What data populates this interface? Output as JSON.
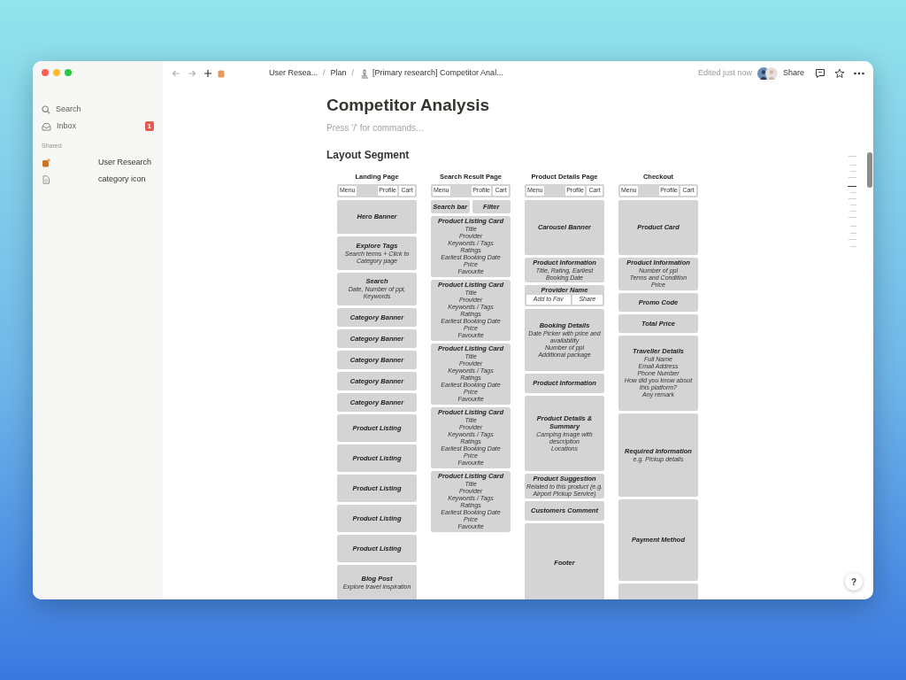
{
  "sidebar": {
    "search": "Search",
    "inbox": {
      "label": "Inbox",
      "badge": "1"
    },
    "shared_heading": "Shared",
    "shared_items": [
      {
        "label": "User Research",
        "kind": "workspace"
      },
      {
        "label": "category icon",
        "kind": "page"
      }
    ]
  },
  "breadcrumb": [
    {
      "label": "User Resea...",
      "kind": "workspace"
    },
    {
      "separator": "/",
      "label": "Plan",
      "kind": "plain"
    },
    {
      "separator": "/",
      "label": "[Primary research] Competitor Anal...",
      "kind": "research"
    }
  ],
  "edited": "Edited just now",
  "share": "Share",
  "document": {
    "title": "Competitor Analysis",
    "placeholder": "Press '/' for commands...",
    "heading": "Layout Segment"
  },
  "wireframe": [
    {
      "title": "Landing Page",
      "blocks": [
        {
          "kind": "nav",
          "buttons": [
            "Menu",
            "Profile",
            "Cart"
          ]
        },
        {
          "kind": "box",
          "title": "Hero Banner"
        },
        {
          "kind": "box",
          "title": "Explore Tags",
          "lines": [
            "Search terms + Click to Category page"
          ]
        },
        {
          "kind": "box",
          "title": "Search",
          "lines": [
            "Date, Number of ppl, Keywords"
          ]
        },
        {
          "kind": "box",
          "title": "Category Banner"
        },
        {
          "kind": "box",
          "title": "Category Banner"
        },
        {
          "kind": "box",
          "title": "Category Banner"
        },
        {
          "kind": "box",
          "title": "Category Banner"
        },
        {
          "kind": "box",
          "title": "Category Banner"
        },
        {
          "kind": "box",
          "title": "Product Listing"
        },
        {
          "kind": "box",
          "title": "Product Listing"
        },
        {
          "kind": "box",
          "title": "Product Listing"
        },
        {
          "kind": "box",
          "title": "Product Listing"
        },
        {
          "kind": "box",
          "title": "Product Listing"
        },
        {
          "kind": "box",
          "title": "Blog Post",
          "lines": [
            "Explore travel inspiration"
          ]
        }
      ]
    },
    {
      "title": "Search Result Page",
      "blocks": [
        {
          "kind": "nav",
          "buttons": [
            "Menu",
            "Profile",
            "Cart"
          ]
        },
        {
          "kind": "pair",
          "items": [
            "Search bar",
            "Filter"
          ]
        },
        {
          "kind": "box",
          "title": "Product Listing Card",
          "lines": [
            "Title",
            "Provider",
            "Keywords / Tags",
            "Ratings",
            "Earliest Booking Date",
            "Price",
            "Favourite"
          ]
        },
        {
          "kind": "box",
          "title": "Product Listing Card",
          "lines": [
            "Title",
            "Provider",
            "Keywords / Tags",
            "Ratings",
            "Earliest Booking Date",
            "Price",
            "Favourite"
          ]
        },
        {
          "kind": "box",
          "title": "Product Listing Card",
          "lines": [
            "Title",
            "Provider",
            "Keywords / Tags",
            "Ratings",
            "Earliest Booking Date",
            "Price",
            "Favourite"
          ]
        },
        {
          "kind": "box",
          "title": "Product Listing Card",
          "lines": [
            "Title",
            "Provider",
            "Keywords / Tags",
            "Ratings",
            "Earliest Booking Date",
            "Price",
            "Favourite"
          ]
        },
        {
          "kind": "box",
          "title": "Product Listing Card",
          "lines": [
            "Title",
            "Provider",
            "Keywords / Tags",
            "Ratings",
            "Earliest Booking Date",
            "Price",
            "Favourite"
          ]
        }
      ]
    },
    {
      "title": "Product Details Page",
      "blocks": [
        {
          "kind": "nav",
          "buttons": [
            "Menu",
            "Profile",
            "Cart"
          ]
        },
        {
          "kind": "box",
          "title": "Carousel Banner"
        },
        {
          "kind": "box",
          "title": "Product Information",
          "lines": [
            "Title, Rating, Earliest Booking Date"
          ]
        },
        {
          "kind": "provider",
          "title": "Provider Name",
          "buttons": [
            "Add to Fav",
            "Share"
          ]
        },
        {
          "kind": "box",
          "title": "Booking Details",
          "lines": [
            "Date Picker with price and availability",
            "Number of ppl",
            "Additional package"
          ]
        },
        {
          "kind": "box",
          "title": "Product Information"
        },
        {
          "kind": "box",
          "title": "Product Details & Summary",
          "lines": [
            "Camping image with description",
            "Locations"
          ]
        },
        {
          "kind": "box",
          "title": "Product Suggestion",
          "lines": [
            "Related to this product (e.g. Airport Pickup Service)"
          ]
        },
        {
          "kind": "box",
          "title": "Customers Comment"
        },
        {
          "kind": "box",
          "title": "Footer"
        }
      ]
    },
    {
      "title": "Checkout",
      "blocks": [
        {
          "kind": "nav",
          "buttons": [
            "Menu",
            "Profile",
            "Cart"
          ]
        },
        {
          "kind": "box",
          "title": "Product Card"
        },
        {
          "kind": "box",
          "title": "Product Information",
          "lines": [
            "Number of ppl",
            "Terms and Condition",
            "Price"
          ]
        },
        {
          "kind": "box",
          "title": "Promo Code"
        },
        {
          "kind": "box",
          "title": "Total Price"
        },
        {
          "kind": "box",
          "title": "Traveller Details",
          "lines": [
            "Full Name",
            "Email Address",
            "Phone Number",
            "How did you know about this platform?",
            "Any remark"
          ]
        },
        {
          "kind": "box",
          "title": "Required Information",
          "lines": [
            "e.g. Pickup details"
          ]
        },
        {
          "kind": "box",
          "title": "Payment Method"
        },
        {
          "kind": "blank"
        }
      ]
    }
  ],
  "help": "?"
}
